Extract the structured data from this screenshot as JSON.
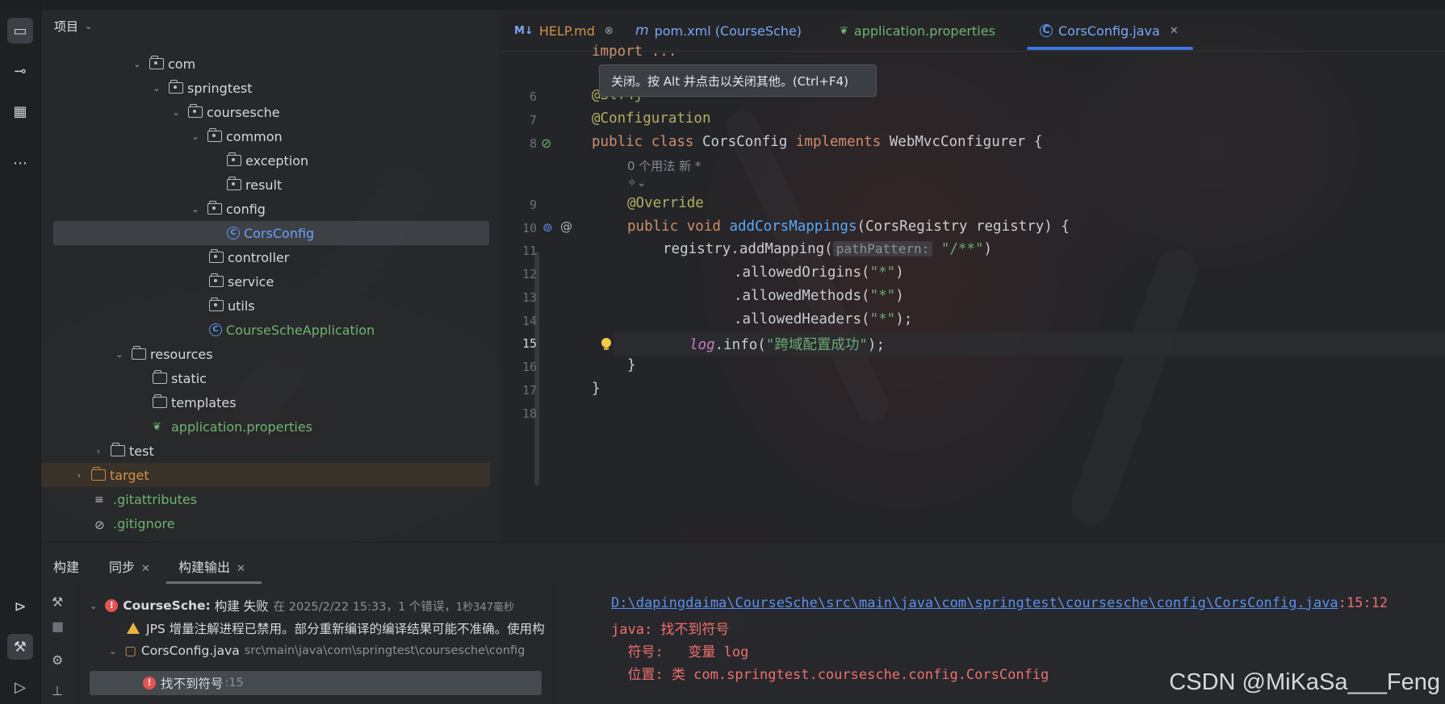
{
  "project_panel": {
    "title": "项目",
    "tree": [
      {
        "label": "com",
        "depth": 0,
        "kind": "package",
        "expanded": true
      },
      {
        "label": "springtest",
        "depth": 1,
        "kind": "package",
        "expanded": true
      },
      {
        "label": "coursesche",
        "depth": 2,
        "kind": "package",
        "expanded": true
      },
      {
        "label": "common",
        "depth": 3,
        "kind": "package",
        "expanded": true
      },
      {
        "label": "exception",
        "depth": 4,
        "kind": "package"
      },
      {
        "label": "result",
        "depth": 4,
        "kind": "package"
      },
      {
        "label": "config",
        "depth": 3,
        "kind": "package",
        "expanded": true
      },
      {
        "label": "CorsConfig",
        "depth": 4,
        "kind": "class",
        "selected": true
      },
      {
        "label": "controller",
        "depth": 3,
        "kind": "package"
      },
      {
        "label": "service",
        "depth": 3,
        "kind": "package"
      },
      {
        "label": "utils",
        "depth": 3,
        "kind": "package"
      },
      {
        "label": "CourseScheApplication",
        "depth": 3,
        "kind": "app-class"
      },
      {
        "label": "resources",
        "depth": 1,
        "kind": "resources-folder",
        "expanded": true
      },
      {
        "label": "static",
        "depth": 2,
        "kind": "folder"
      },
      {
        "label": "templates",
        "depth": 2,
        "kind": "folder"
      },
      {
        "label": "application.properties",
        "depth": 2,
        "kind": "properties"
      },
      {
        "label": "test",
        "depth": 0,
        "kind": "folder",
        "collapsed": true
      },
      {
        "label": "target",
        "depth": -1,
        "kind": "excluded-folder",
        "collapsed": true
      },
      {
        "label": ".gitattributes",
        "depth": -1,
        "kind": "file"
      },
      {
        "label": ".gitignore",
        "depth": -1,
        "kind": "ignore-file"
      }
    ]
  },
  "tabs": [
    {
      "label": "HELP.md",
      "icon": "markdown-icon",
      "closable": true
    },
    {
      "label": "pom.xml (CourseSche)",
      "icon": "maven-icon"
    },
    {
      "label": "application.properties",
      "icon": "spring-leaf-icon"
    },
    {
      "label": "CorsConfig.java",
      "icon": "class-icon",
      "active": true,
      "closable": true
    }
  ],
  "tooltip": "关闭。按 Alt 并点击以关闭其他。(Ctrl+F4)",
  "editor": {
    "line_numbers": [
      "6",
      "7",
      "8",
      "9",
      "10",
      "11",
      "12",
      "13",
      "14",
      "15",
      "16",
      "17",
      "18"
    ],
    "top_fragment": "import ...",
    "lines": {
      "l6": "@Slf4j",
      "l7": "@Configuration",
      "l8_kw1": "public class",
      "l8_name": " CorsConfig ",
      "l8_kw2": "implements",
      "l8_rest": " WebMvcConfigurer {",
      "usage_hint": "0 个用法   新 *",
      "l9": "@Override",
      "l10_kw": "public void ",
      "l10_fn": "addCorsMappings",
      "l10_rest": "(CorsRegistry registry) {",
      "l11_a": "registry.addMapping(",
      "l11_hint": "pathPattern:",
      "l11_str": "\"/**\"",
      "l11_end": ")",
      "l12_a": ".allowedOrigins(",
      "l12_s": "\"*\"",
      "l12_e": ")",
      "l13_a": ".allowedMethods(",
      "l13_s": "\"*\"",
      "l13_e": ")",
      "l14_a": ".allowedHeaders(",
      "l14_s": "\"*\"",
      "l14_e": ");",
      "l15_log": "log",
      "l15_a": ".info(",
      "l15_s": "\"跨域配置成功\"",
      "l15_e": ");",
      "l16": "}",
      "l17": "}"
    }
  },
  "build_panel": {
    "tabs": [
      {
        "label": "构建"
      },
      {
        "label": "同步",
        "closable": true
      },
      {
        "label": "构建输出",
        "closable": true,
        "active": true
      }
    ],
    "tree": {
      "root_label": "CourseSche:",
      "root_status": "构建 失败",
      "root_meta": "在 2025/2/22 15:33，1 个错误，",
      "root_duration": "1秒347毫秒",
      "warning": "JPS 增量注解进程已禁用。部分重新编译的编译结果可能不准确。使用构",
      "file_label": "CorsConfig.java",
      "file_path": "src\\main\\java\\com\\springtest\\coursesche\\config",
      "error_label": "找不到符号",
      "error_pos": ":15"
    },
    "output": {
      "path": "D:\\dapingdaima\\CourseSche\\src\\main\\java\\com\\springtest\\coursesche\\config\\CorsConfig.java",
      "position": ":15:12",
      "line1": "java: 找不到符号",
      "line2_label": "  符号:   ",
      "line2_value": "变量 log",
      "line3": "  位置: 类 com.springtest.coursesche.config.CorsConfig"
    }
  },
  "watermark": "CSDN @MiKaSa___Feng"
}
